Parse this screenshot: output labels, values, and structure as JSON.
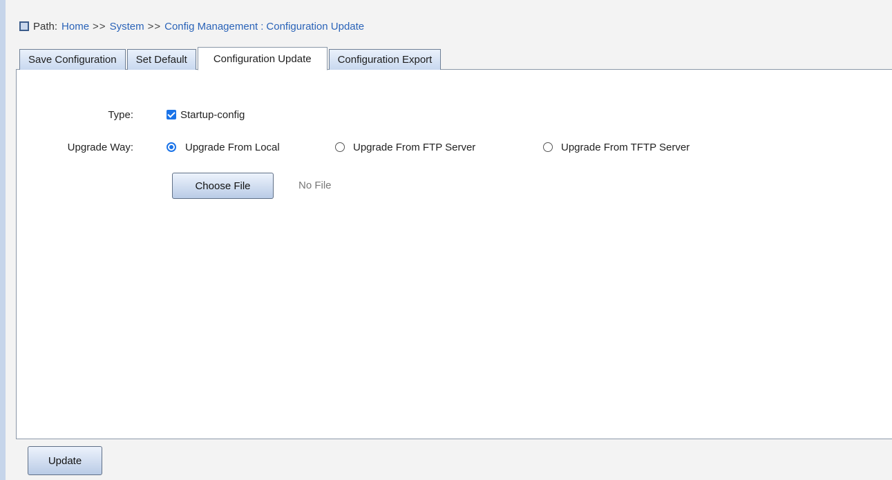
{
  "breadcrumb": {
    "label": "Path:",
    "home": "Home",
    "sep1": ">>",
    "system": "System",
    "sep2": ">>",
    "config_mgmt": "Config Management",
    "colon": ":",
    "current": "Configuration Update"
  },
  "tabs": [
    {
      "label": "Save Configuration",
      "active": false
    },
    {
      "label": "Set Default",
      "active": false
    },
    {
      "label": "Configuration Update",
      "active": true
    },
    {
      "label": "Configuration Export",
      "active": false
    }
  ],
  "form": {
    "type_label": "Type:",
    "type_option": "Startup-config",
    "type_checked": true,
    "way_label": "Upgrade Way:",
    "way_options": [
      {
        "label": "Upgrade From Local",
        "selected": true
      },
      {
        "label": "Upgrade From FTP Server",
        "selected": false
      },
      {
        "label": "Upgrade From TFTP Server",
        "selected": false
      }
    ],
    "choose_file_label": "Choose File",
    "no_file_text": "No File"
  },
  "footer": {
    "update_label": "Update"
  },
  "colors": {
    "link": "#2a63b8",
    "accent": "#1a73e8",
    "tab_bg": "#c8d8ef",
    "page_bg": "#f3f3f3"
  }
}
